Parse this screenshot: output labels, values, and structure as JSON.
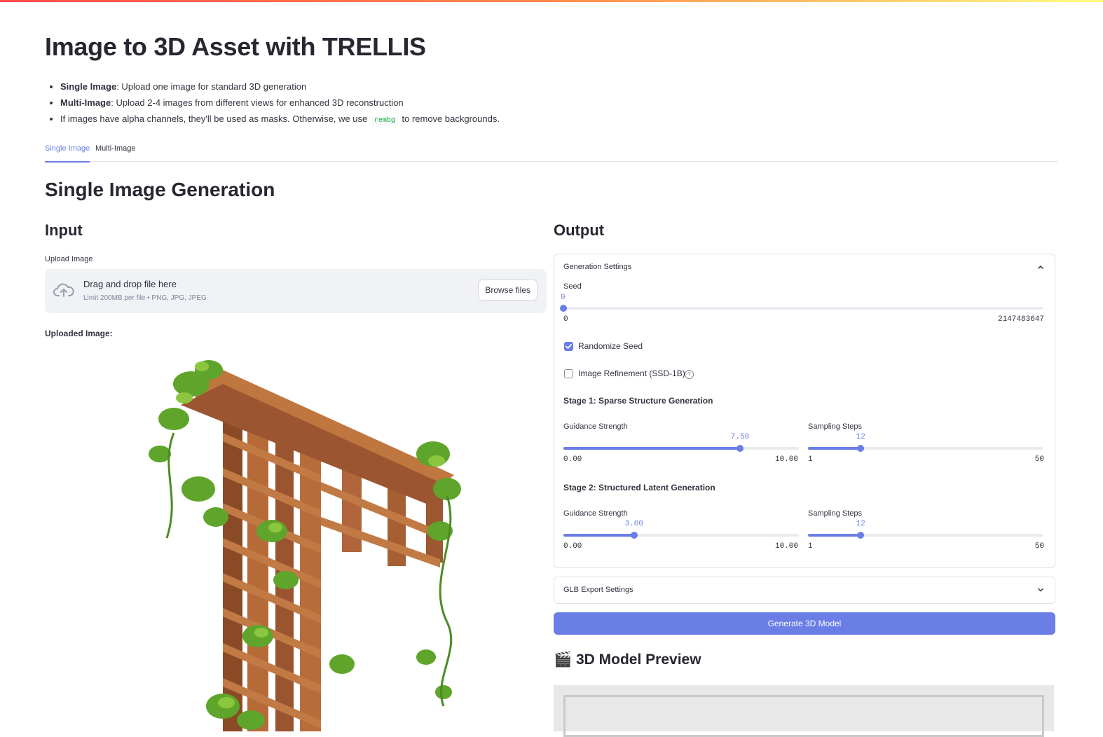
{
  "app": {
    "title": "Image to 3D Asset with TRELLIS",
    "bullets": [
      {
        "bold": "Single Image",
        "text": ": Upload one image for standard 3D generation"
      },
      {
        "bold": "Multi-Image",
        "text": ": Upload 2-4 images from different views for enhanced 3D reconstruction"
      },
      {
        "pre": "If images have alpha channels, they'll be used as masks. Otherwise, we use",
        "code": "rembg",
        "post": "to remove backgrounds."
      }
    ]
  },
  "tabs": [
    {
      "label": "Single Image",
      "active": true
    },
    {
      "label": "Multi-Image",
      "active": false
    }
  ],
  "section_title": "Single Image Generation",
  "input": {
    "heading": "Input",
    "upload_label": "Upload Image",
    "dropzone_main": "Drag and drop file here",
    "dropzone_sub": "Limit 200MB per file • PNG, JPG, JPEG",
    "browse_label": "Browse files",
    "uploaded_label": "Uploaded Image:"
  },
  "output": {
    "heading": "Output",
    "generation_settings": {
      "title": "Generation Settings",
      "expanded": true,
      "seed": {
        "label": "Seed",
        "value": "0",
        "min": "0",
        "max": "2147483647",
        "fraction": 0.0
      },
      "randomize_seed": {
        "label": "Randomize Seed",
        "checked": true
      },
      "image_refinement": {
        "label": "Image Refinement (SSD-1B)",
        "checked": false,
        "help": "?"
      },
      "stage1": {
        "title": "Stage 1: Sparse Structure Generation",
        "guidance": {
          "label": "Guidance Strength",
          "value": "7.50",
          "min": "0.00",
          "max": "10.00",
          "fraction": 0.75
        },
        "steps": {
          "label": "Sampling Steps",
          "value": "12",
          "min": "1",
          "max": "50",
          "fraction": 0.2245
        }
      },
      "stage2": {
        "title": "Stage 2: Structured Latent Generation",
        "guidance": {
          "label": "Guidance Strength",
          "value": "3.00",
          "min": "0.00",
          "max": "10.00",
          "fraction": 0.3
        },
        "steps": {
          "label": "Sampling Steps",
          "value": "12",
          "min": "1",
          "max": "50",
          "fraction": 0.2245
        }
      }
    },
    "glb_settings": {
      "title": "GLB Export Settings",
      "expanded": false
    },
    "generate_label": "Generate 3D Model",
    "preview_title": "🎬 3D Model Preview"
  },
  "colors": {
    "accent": "#6a7ee6",
    "code": "#09ab3b",
    "dropzone_bg": "#f0f2f6"
  }
}
